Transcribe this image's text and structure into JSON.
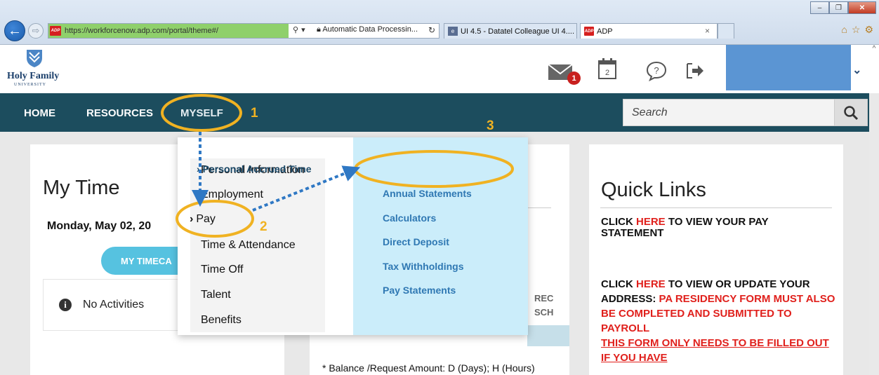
{
  "browser": {
    "url": "https://workforcenow.adp.com/portal/theme#/",
    "favicon_label": "ADP",
    "site_identity": "Automatic Data Processin...",
    "tabs": [
      {
        "label": "UI 4.5 - Datatel Colleague UI 4...."
      },
      {
        "label": "ADP"
      }
    ],
    "tab_close": "×",
    "win_minimize": "–",
    "win_maximize": "❐",
    "win_close": "✕",
    "chrome_icons": [
      "home-icon",
      "star-icon",
      "gear-icon"
    ]
  },
  "header": {
    "logo_name": "Holy Family",
    "logo_sub": "UNIVERSITY",
    "mail_badge": "1",
    "calendar_day": "2",
    "icons": [
      "mail-icon",
      "calendar-icon",
      "chat-icon",
      "logout-icon"
    ]
  },
  "nav": {
    "items": [
      {
        "label": "HOME"
      },
      {
        "label": "RESOURCES"
      },
      {
        "label": "MYSELF"
      }
    ],
    "search_placeholder": "Search"
  },
  "dropdown": {
    "left_items": [
      {
        "label": "Personal Information"
      },
      {
        "label": "Employment"
      },
      {
        "label": "Pay"
      },
      {
        "label": "Time & Attendance"
      },
      {
        "label": "Time Off"
      },
      {
        "label": "Talent"
      },
      {
        "label": "Benefits"
      }
    ],
    "right_items": [
      {
        "label": "Personal Accrued Time"
      },
      {
        "label": "Annual Statements"
      },
      {
        "label": "Calculators"
      },
      {
        "label": "Direct Deposit"
      },
      {
        "label": "Tax Withholdings"
      },
      {
        "label": "Pay Statements"
      }
    ],
    "chevron": "›"
  },
  "my_time": {
    "title": "My Time",
    "date": "Monday, May 02, 20",
    "timecard_button": "MY TIMECA",
    "no_activities": "No Activities"
  },
  "middle": {
    "col_header_1": "REC",
    "col_header_2": "SCH",
    "note": "* Balance /Request Amount: D (Days); H (Hours)"
  },
  "quick_links": {
    "title": "Quick Links",
    "p1_pre": "CLICK ",
    "p1_link": "HERE",
    "p1_post": " TO VIEW YOUR PAY STATEMENT",
    "p2_pre": "CLICK ",
    "p2_link": "HERE",
    "p2_mid": " TO VIEW OR UPDATE YOUR ADDRESS:  ",
    "p2_red": "PA RESIDENCY FORM MUST ALSO BE COMPLETED AND SUBMITTED TO PAYROLL",
    "p2_red_ul": "THIS FORM ONLY NEEDS TO BE FILLED OUT IF YOU HAVE"
  },
  "annotations": {
    "steps": [
      {
        "number": "1"
      },
      {
        "number": "2"
      },
      {
        "number": "3"
      }
    ],
    "highlight_color": "#f0b222",
    "arrow_color": "#2f78c4"
  }
}
